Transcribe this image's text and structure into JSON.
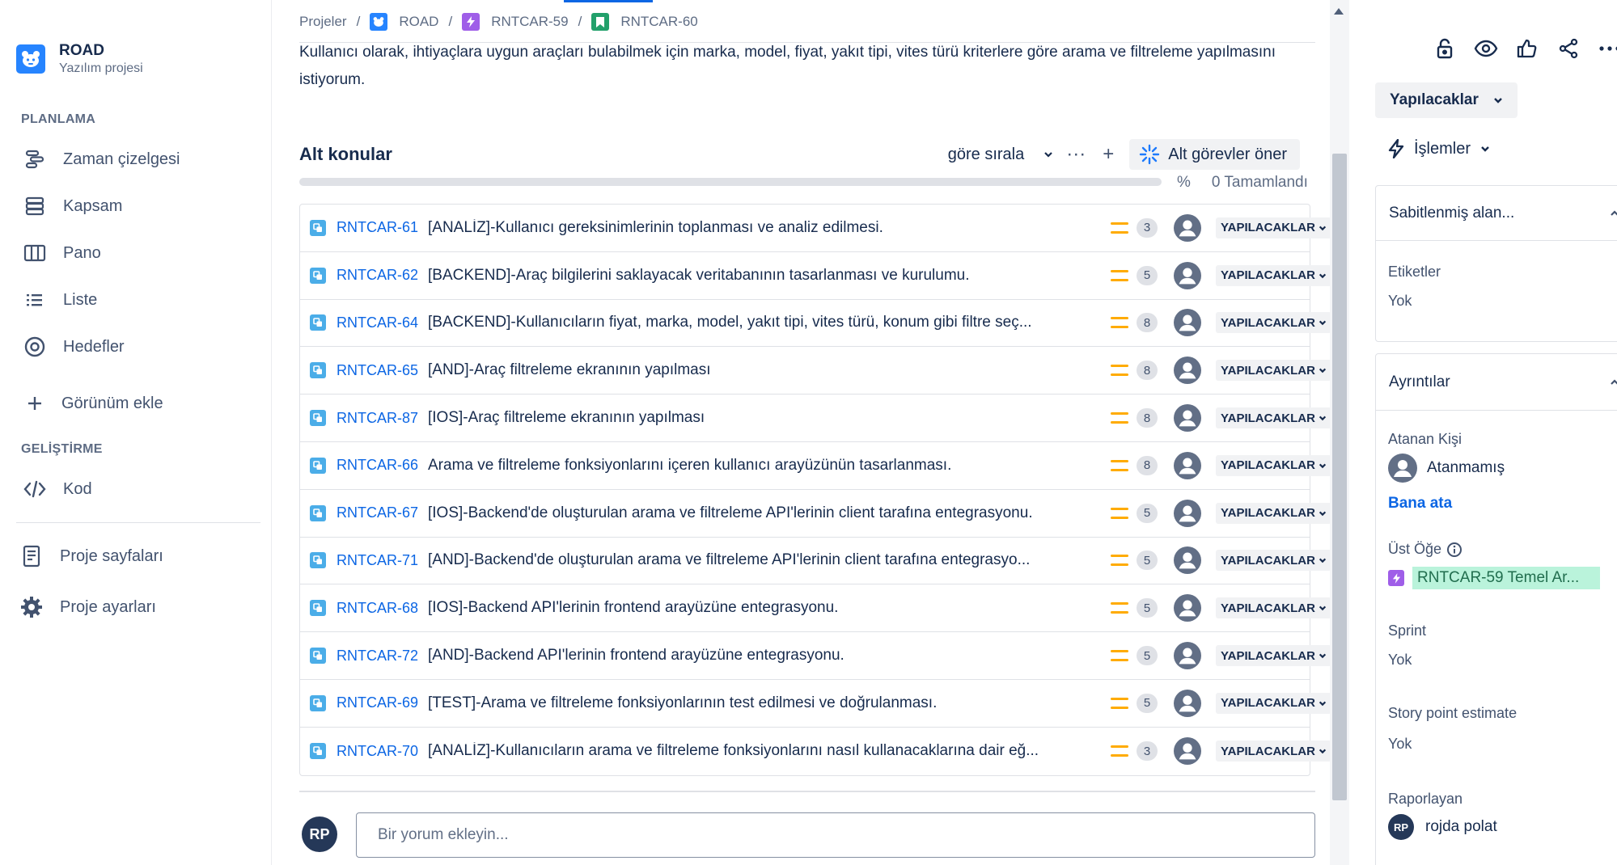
{
  "project": {
    "name": "ROAD",
    "type": "Yazılım projesi"
  },
  "sidebar": {
    "section_planning": "PLANLAMA",
    "section_dev": "GELİŞTİRME",
    "items": [
      {
        "label": "Zaman çizelgesi",
        "icon": "timeline-icon"
      },
      {
        "label": "Kapsam",
        "icon": "backlog-icon"
      },
      {
        "label": "Pano",
        "icon": "board-icon"
      },
      {
        "label": "Liste",
        "icon": "list-icon"
      },
      {
        "label": "Hedefler",
        "icon": "goals-icon"
      },
      {
        "label": "Görünüm ekle",
        "icon": "plus-icon"
      },
      {
        "label": "Kod",
        "icon": "code-icon"
      },
      {
        "label": "Proje sayfaları",
        "icon": "pages-icon"
      },
      {
        "label": "Proje ayarları",
        "icon": "settings-icon"
      }
    ]
  },
  "breadcrumb": {
    "items": [
      "Projeler",
      "ROAD",
      "RNTCAR-59",
      "RNTCAR-60"
    ],
    "separator": "/"
  },
  "description": "Kullanıcı olarak, ihtiyaçlara uygun araçları bulabilmek için  marka, model, fiyat, yakıt tipi, vites türü kriterlere göre arama ve filtreleme yapılmasını istiyorum.",
  "subtasks": {
    "title": "Alt konular",
    "sort_label": "göre sırala",
    "more_label": "···",
    "add_label": "+",
    "suggest_label": "Alt görevler öner",
    "progress_percent_symbol": "%",
    "progress_text": "0 Tamamlandı",
    "progress_done": 0,
    "rows": [
      {
        "key": "RNTCAR-61",
        "summary": "[ANALİZ]-Kullanıcı gereksinimlerinin toplanması ve analiz edilmesi.",
        "points": "3",
        "status": "YAPILACAKLAR"
      },
      {
        "key": "RNTCAR-62",
        "summary": "[BACKEND]-Araç bilgilerini saklayacak veritabanının tasarlanması ve kurulumu.",
        "points": "5",
        "status": "YAPILACAKLAR"
      },
      {
        "key": "RNTCAR-64",
        "summary": "[BACKEND]-Kullanıcıların fiyat, marka, model, yakıt tipi, vites türü, konum gibi filtre seç...",
        "points": "8",
        "status": "YAPILACAKLAR"
      },
      {
        "key": "RNTCAR-65",
        "summary": "[AND]-Araç filtreleme ekranının yapılması",
        "points": "8",
        "status": "YAPILACAKLAR"
      },
      {
        "key": "RNTCAR-87",
        "summary": "[IOS]-Araç filtreleme ekranının yapılması",
        "points": "8",
        "status": "YAPILACAKLAR"
      },
      {
        "key": "RNTCAR-66",
        "summary": "Arama ve filtreleme fonksiyonlarını içeren kullanıcı arayüzünün tasarlanması.",
        "points": "8",
        "status": "YAPILACAKLAR"
      },
      {
        "key": "RNTCAR-67",
        "summary": "[IOS]-Backend'de oluşturulan arama ve filtreleme API'lerinin client tarafına entegrasyonu.",
        "points": "5",
        "status": "YAPILACAKLAR"
      },
      {
        "key": "RNTCAR-71",
        "summary": "[AND]-Backend'de oluşturulan arama ve filtreleme API'lerinin client tarafına entegrasyo...",
        "points": "5",
        "status": "YAPILACAKLAR"
      },
      {
        "key": "RNTCAR-68",
        "summary": "[IOS]-Backend API'lerinin frontend arayüzüne entegrasyonu.",
        "points": "5",
        "status": "YAPILACAKLAR"
      },
      {
        "key": "RNTCAR-72",
        "summary": "[AND]-Backend API'lerinin frontend arayüzüne entegrasyonu.",
        "points": "5",
        "status": "YAPILACAKLAR"
      },
      {
        "key": "RNTCAR-69",
        "summary": "[TEST]-Arama ve filtreleme fonksiyonlarının test edilmesi ve doğrulanması.",
        "points": "5",
        "status": "YAPILACAKLAR"
      },
      {
        "key": "RNTCAR-70",
        "summary": "[ANALİZ]-Kullanıcıların arama ve filtreleme fonksiyonlarını nasıl kullanacaklarına dair eğ...",
        "points": "3",
        "status": "YAPILACAKLAR"
      }
    ]
  },
  "comment": {
    "avatar_initials": "RP",
    "placeholder": "Bir yorum ekleyin..."
  },
  "right_panel": {
    "header_icons": [
      "lock-icon",
      "watch-icon",
      "like-icon",
      "share-icon",
      "more-icon"
    ],
    "status_button": "Yapılacaklar",
    "actions_label": "İşlemler",
    "pinned_title": "Sabitlenmiş alan...",
    "labels_label": "Etiketler",
    "labels_value": "Yok",
    "details_title": "Ayrıntılar",
    "assignee_label": "Atanan Kişi",
    "assignee_value": "Atanmamış",
    "assign_me": "Bana ata",
    "parent_label": "Üst Öğe",
    "parent_value": "RNTCAR-59 Temel Ar...",
    "sprint_label": "Sprint",
    "sprint_value": "Yok",
    "story_point_label": "Story point estimate",
    "story_point_value": "Yok",
    "reporter_label": "Raporlayan",
    "reporter_initials": "RP",
    "reporter_name": "rojda polat"
  },
  "colors": {
    "link": "#0c66e4",
    "priority_medium": "#ffab00",
    "subtask_type": "#4bade8",
    "epic": "#9f5ee8",
    "story": "#22a06b",
    "parent_chip_bg": "#baf3db"
  }
}
